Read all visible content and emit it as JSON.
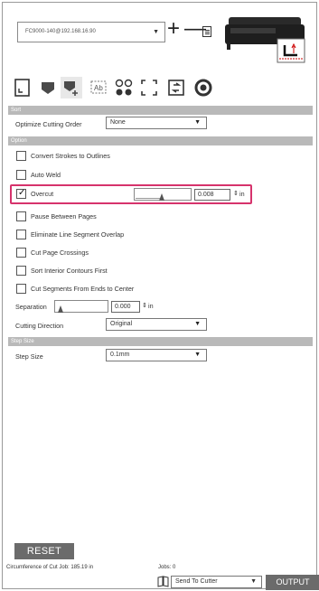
{
  "device": {
    "selected": "FC9000-140@192.168.16.90",
    "add_symbol": "+",
    "remove_symbol": "—"
  },
  "toolbar": {
    "icons": [
      "page-setup-icon",
      "cut-settings-icon",
      "advanced-cut-settings-icon",
      "trace-icon",
      "registration-marks-icon",
      "crop-icon",
      "pen-settings-icon",
      "sponsor-icon"
    ]
  },
  "sections": {
    "sort": {
      "title": "Sort",
      "optimize_label": "Optimize Cutting Order",
      "optimize_value": "None"
    },
    "option": {
      "title": "Option",
      "convert_strokes": "Convert Strokes to Outlines",
      "auto_weld": "Auto Weld",
      "overcut": "Overcut",
      "overcut_checked": true,
      "overcut_value": "0.008",
      "overcut_unit": "in",
      "pause_between_pages": "Pause Between Pages",
      "eliminate_overlap": "Eliminate Line Segment Overlap",
      "cut_page_crossings": "Cut Page Crossings",
      "sort_interior": "Sort Interior Contours First",
      "cut_segments": "Cut Segments From Ends to Center",
      "separation_label": "Separation",
      "separation_value": "0.000",
      "separation_unit": "in",
      "cutting_direction_label": "Cutting Direction",
      "cutting_direction_value": "Original"
    },
    "step_size": {
      "title": "Step Size",
      "label": "Step Size",
      "value": "0.1mm"
    }
  },
  "footer": {
    "reset": "RESET",
    "circumference": "Circumference of Cut Job: 185.19 in",
    "jobs": "Jobs: 0",
    "send_target": "Send To Cutter",
    "output": "OUTPUT"
  },
  "colors": {
    "section_header": "#b9b9b9",
    "highlight": "#d6336c",
    "button": "#6b6b6b"
  }
}
